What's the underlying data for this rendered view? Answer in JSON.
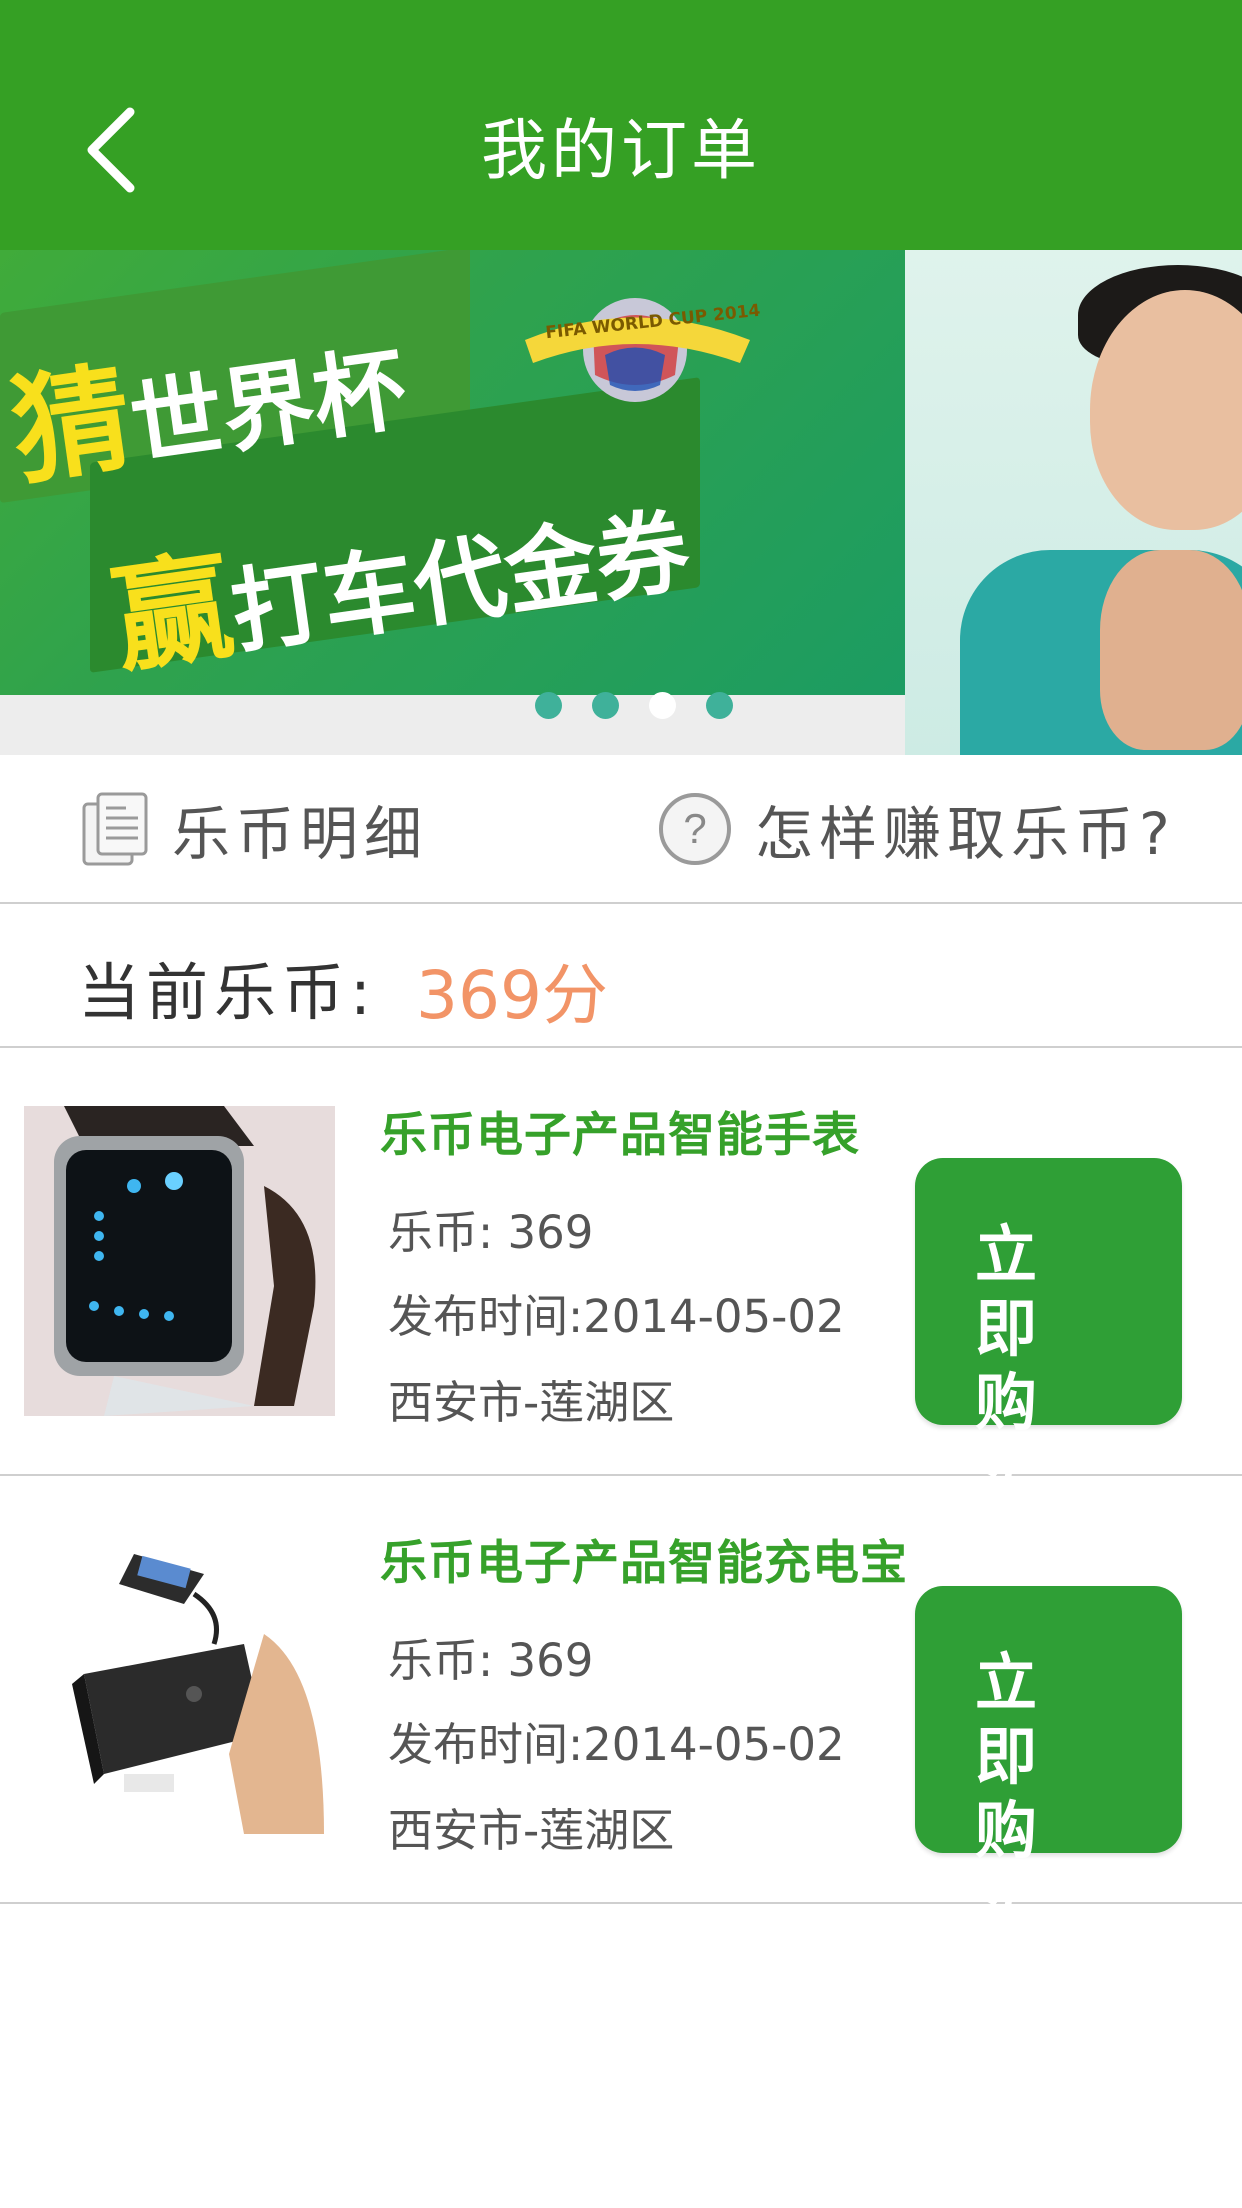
{
  "header": {
    "title": "我的订单",
    "background": "#35a024"
  },
  "banner": {
    "slogan": {
      "line1_accent": "猜",
      "line1_rest": "世界杯",
      "line2_accent": "赢",
      "line2_rest": "打车代金券"
    },
    "badge_text": "FIFA WORLD CUP 2014",
    "page_count": 4,
    "active_page": 3
  },
  "links": {
    "details_label": "乐币明细",
    "how_to_earn_label": "怎样赚取乐币?"
  },
  "balance": {
    "label": "当前乐币:",
    "value": "369分",
    "value_color": "#f29467"
  },
  "products": [
    {
      "title": "乐币电子产品智能手表",
      "coins": "乐币: 369",
      "published": "发布时间:2014-05-02",
      "location": "西安市-莲湖区",
      "button_label": "立即购买"
    },
    {
      "title": "乐币电子产品智能充电宝",
      "coins": "乐币: 369",
      "published": "发布时间:2014-05-02",
      "location": "西安市-莲湖区",
      "button_label": "立即购买"
    }
  ],
  "colors": {
    "accent_green": "#36a12a",
    "button_green": "#2f9f36"
  }
}
